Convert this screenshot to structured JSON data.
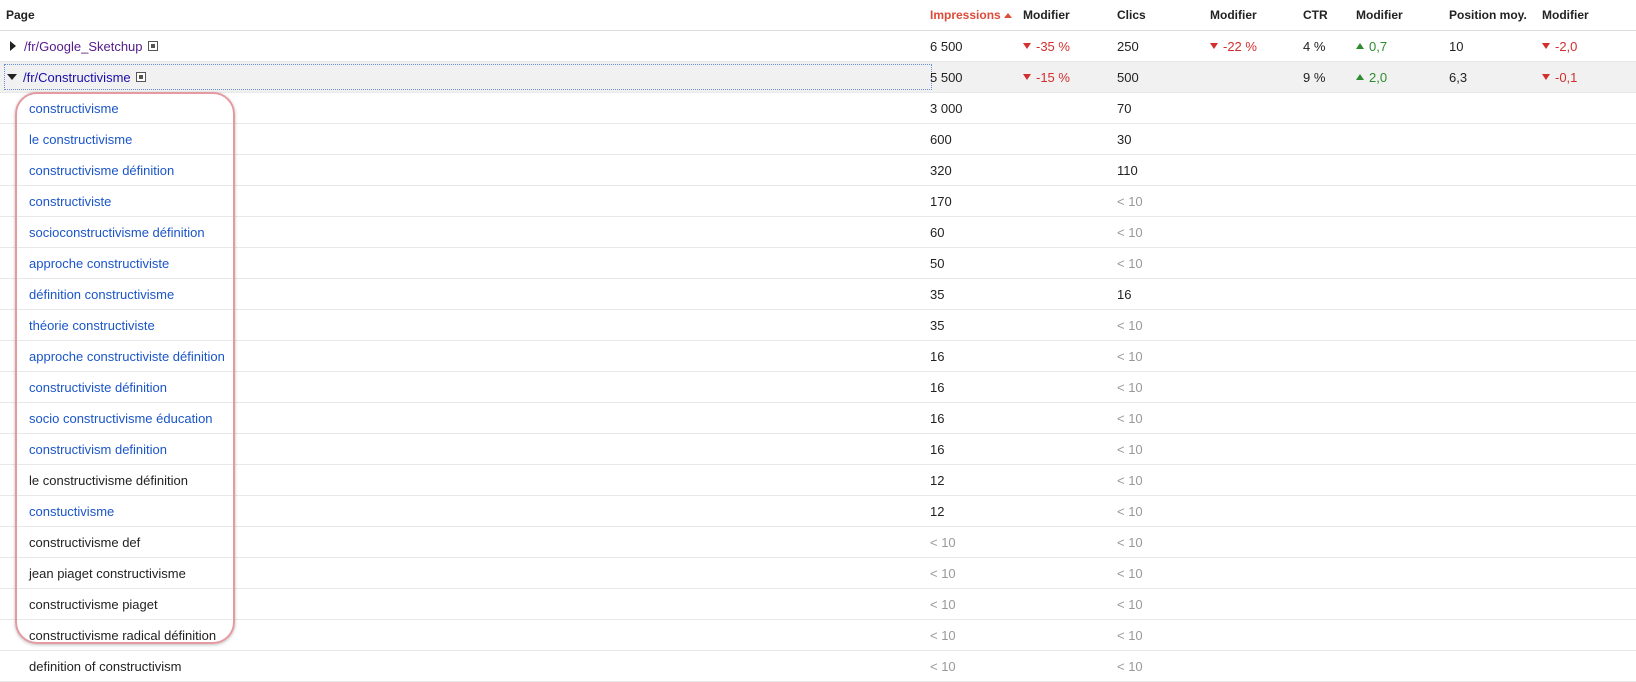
{
  "headers": {
    "page": "Page",
    "impressions": "Impressions",
    "modifier": "Modifier",
    "clicks": "Clics",
    "ctr": "CTR",
    "position": "Position moy."
  },
  "pages": [
    {
      "url": "/fr/Google_Sketchup",
      "impressions": "6 500",
      "imp_change": "-35 %",
      "clicks": "250",
      "clicks_change": "-22 %",
      "ctr": "4 %",
      "ctr_change": "0,7",
      "position": "10",
      "position_change": "-2,0"
    },
    {
      "url": "/fr/Constructivisme",
      "impressions": "5 500",
      "imp_change": "-15 %",
      "clicks": "500",
      "clicks_change": "",
      "ctr": "9 %",
      "ctr_change": "2,0",
      "position": "6,3",
      "position_change": "-0,1"
    }
  ],
  "queries": [
    {
      "query": "constructivisme",
      "impressions": "3 000",
      "clicks": "70",
      "link": true
    },
    {
      "query": "le constructivisme",
      "impressions": "600",
      "clicks": "30",
      "link": true
    },
    {
      "query": "constructivisme définition",
      "impressions": "320",
      "clicks": "110",
      "link": true
    },
    {
      "query": "constructiviste",
      "impressions": "170",
      "clicks": "< 10",
      "link": true
    },
    {
      "query": "socioconstructivisme définition",
      "impressions": "60",
      "clicks": "< 10",
      "link": true
    },
    {
      "query": "approche constructiviste",
      "impressions": "50",
      "clicks": "< 10",
      "link": true
    },
    {
      "query": "définition constructivisme",
      "impressions": "35",
      "clicks": "16",
      "link": true
    },
    {
      "query": "théorie constructiviste",
      "impressions": "35",
      "clicks": "< 10",
      "link": true
    },
    {
      "query": "approche constructiviste définition",
      "impressions": "16",
      "clicks": "< 10",
      "link": true
    },
    {
      "query": "constructiviste définition",
      "impressions": "16",
      "clicks": "< 10",
      "link": true
    },
    {
      "query": "socio constructivisme éducation",
      "impressions": "16",
      "clicks": "< 10",
      "link": true
    },
    {
      "query": "constructivism definition",
      "impressions": "16",
      "clicks": "< 10",
      "link": true
    },
    {
      "query": "le constructivisme définition",
      "impressions": "12",
      "clicks": "< 10",
      "link": false
    },
    {
      "query": "constuctivisme",
      "impressions": "12",
      "clicks": "< 10",
      "link": true
    },
    {
      "query": "constructivisme def",
      "impressions": "< 10",
      "clicks": "< 10",
      "link": false
    },
    {
      "query": "jean piaget constructivisme",
      "impressions": "< 10",
      "clicks": "< 10",
      "link": false
    },
    {
      "query": "constructivisme piaget",
      "impressions": "< 10",
      "clicks": "< 10",
      "link": false
    },
    {
      "query": "constructivisme radical définition",
      "impressions": "< 10",
      "clicks": "< 10",
      "link": false
    },
    {
      "query": "definition of constructivism",
      "impressions": "< 10",
      "clicks": "< 10",
      "link": false
    }
  ]
}
